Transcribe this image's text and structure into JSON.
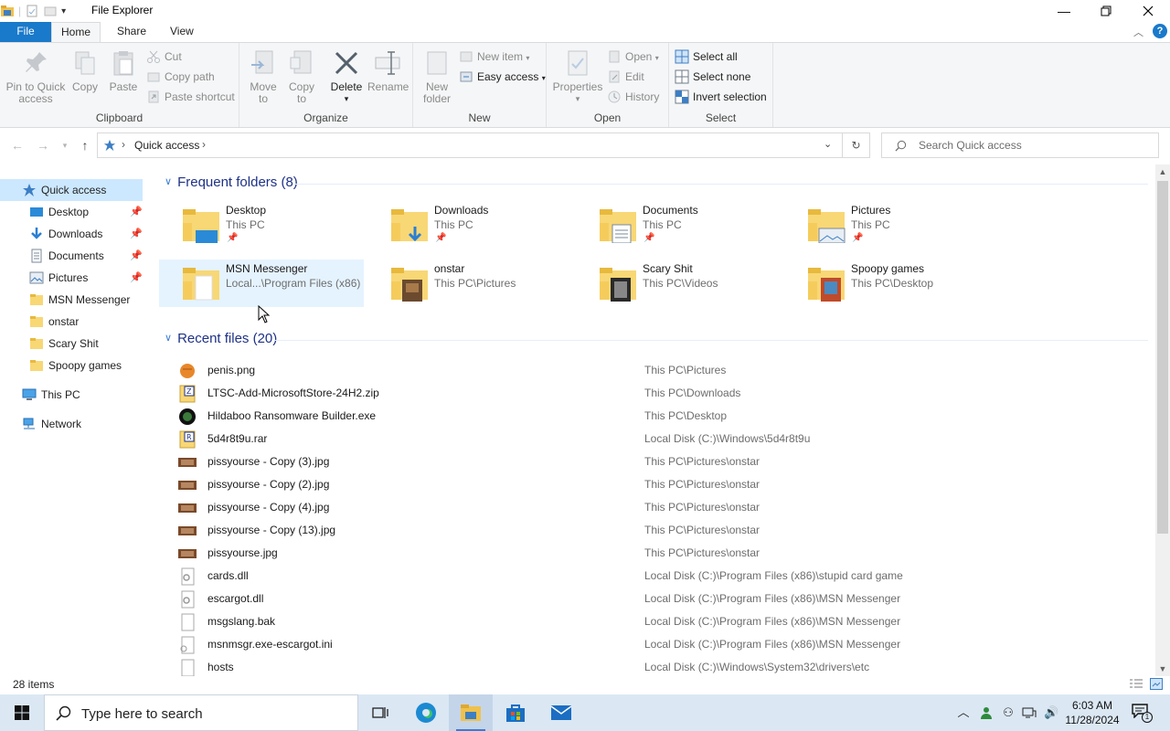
{
  "window": {
    "title": "File Explorer"
  },
  "ribbon_tabs": [
    "File",
    "Home",
    "Share",
    "View"
  ],
  "clipboard": {
    "pin_label_1": "Pin to Quick",
    "pin_label_2": "access",
    "copy": "Copy",
    "paste": "Paste",
    "cut": "Cut",
    "copy_path": "Copy path",
    "paste_shortcut": "Paste shortcut",
    "group": "Clipboard"
  },
  "organize": {
    "move_to_1": "Move",
    "move_to_2": "to",
    "copy_to_1": "Copy",
    "copy_to_2": "to",
    "delete": "Delete",
    "rename": "Rename",
    "group": "Organize"
  },
  "new": {
    "new_folder_1": "New",
    "new_folder_2": "folder",
    "new_item": "New item",
    "easy_access": "Easy access",
    "group": "New"
  },
  "open": {
    "properties": "Properties",
    "open": "Open",
    "edit": "Edit",
    "history": "History",
    "group": "Open"
  },
  "select": {
    "select_all": "Select all",
    "select_none": "Select none",
    "invert_selection": "Invert selection",
    "group": "Select"
  },
  "address": {
    "crumb": "Quick access",
    "search_placeholder": "Search Quick access"
  },
  "nav_pane": {
    "quick_access": "Quick access",
    "pinned": [
      {
        "label": "Desktop",
        "icon": "desktop-icon"
      },
      {
        "label": "Downloads",
        "icon": "downloads-icon"
      },
      {
        "label": "Documents",
        "icon": "documents-icon"
      },
      {
        "label": "Pictures",
        "icon": "pictures-icon"
      }
    ],
    "folders": [
      "MSN Messenger",
      "onstar",
      "Scary Shit",
      "Spoopy games"
    ],
    "this_pc": "This PC",
    "network": "Network"
  },
  "frequent": {
    "header": "Frequent folders (8)",
    "items": [
      {
        "name": "Desktop",
        "path": "This PC",
        "pinned": true
      },
      {
        "name": "Downloads",
        "path": "This PC",
        "pinned": true
      },
      {
        "name": "Documents",
        "path": "This PC",
        "pinned": true
      },
      {
        "name": "Pictures",
        "path": "This PC",
        "pinned": true
      },
      {
        "name": "MSN Messenger",
        "path": "Local...\\Program Files (x86)",
        "pinned": false
      },
      {
        "name": "onstar",
        "path": "This PC\\Pictures",
        "pinned": false
      },
      {
        "name": "Scary Shit",
        "path": "This PC\\Videos",
        "pinned": false
      },
      {
        "name": "Spoopy games",
        "path": "This PC\\Desktop",
        "pinned": false
      }
    ]
  },
  "recent": {
    "header": "Recent files (20)",
    "items": [
      {
        "name": "penis.png",
        "path": "This PC\\Pictures",
        "icon": "png-icon"
      },
      {
        "name": "LTSC-Add-MicrosoftStore-24H2.zip",
        "path": "This PC\\Downloads",
        "icon": "zip-icon"
      },
      {
        "name": "Hildaboo Ransomware Builder.exe",
        "path": "This PC\\Desktop",
        "icon": "exe-icon"
      },
      {
        "name": "5d4r8t9u.rar",
        "path": "Local Disk (C:)\\Windows\\5d4r8t9u",
        "icon": "rar-icon"
      },
      {
        "name": "pissyourse - Copy (3).jpg",
        "path": "This PC\\Pictures\\onstar",
        "icon": "jpg-icon"
      },
      {
        "name": "pissyourse - Copy (2).jpg",
        "path": "This PC\\Pictures\\onstar",
        "icon": "jpg-icon"
      },
      {
        "name": "pissyourse - Copy (4).jpg",
        "path": "This PC\\Pictures\\onstar",
        "icon": "jpg-icon"
      },
      {
        "name": "pissyourse - Copy (13).jpg",
        "path": "This PC\\Pictures\\onstar",
        "icon": "jpg-icon"
      },
      {
        "name": "pissyourse.jpg",
        "path": "This PC\\Pictures\\onstar",
        "icon": "jpg-icon"
      },
      {
        "name": "cards.dll",
        "path": "Local Disk (C:)\\Program Files (x86)\\stupid card game",
        "icon": "dll-icon"
      },
      {
        "name": "escargot.dll",
        "path": "Local Disk (C:)\\Program Files (x86)\\MSN Messenger",
        "icon": "dll-icon"
      },
      {
        "name": "msgslang.bak",
        "path": "Local Disk (C:)\\Program Files (x86)\\MSN Messenger",
        "icon": "file-icon"
      },
      {
        "name": "msnmsgr.exe-escargot.ini",
        "path": "Local Disk (C:)\\Program Files (x86)\\MSN Messenger",
        "icon": "ini-icon"
      },
      {
        "name": "hosts",
        "path": "Local Disk (C:)\\Windows\\System32\\drivers\\etc",
        "icon": "file-icon"
      }
    ]
  },
  "status": {
    "count": "28 items"
  },
  "taskbar": {
    "search_placeholder": "Type here to search",
    "time": "6:03 AM",
    "date": "11/28/2024",
    "notif_count": "1"
  },
  "colors": {
    "accent": "#1979ca",
    "selection": "#cce8ff",
    "folder": "#f8d775",
    "taskbar": "#dbe7f3"
  }
}
